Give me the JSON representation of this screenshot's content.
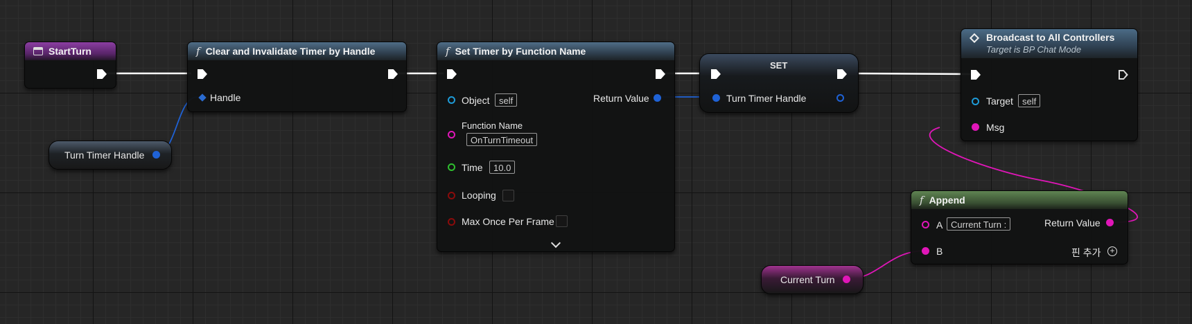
{
  "colors": {
    "exec": "#ffffff",
    "struct_pin": "#1f62d6",
    "object_pin": "#1e9bd8",
    "string_pin": "#e016b8",
    "float_pin": "#2fbf2f",
    "bool_pin": "#8a0b0b"
  },
  "start_turn": {
    "title": "StartTurn",
    "icon": "event-icon"
  },
  "clear_timer": {
    "title": "Clear and Invalidate Timer by Handle",
    "icon": "function-icon",
    "handle_label": "Handle"
  },
  "turn_timer_var": {
    "label": "Turn Timer Handle"
  },
  "set_timer": {
    "title": "Set Timer by Function Name",
    "icon": "function-icon",
    "object_label": "Object",
    "object_value": "self",
    "return_label": "Return Value",
    "function_name_label": "Function Name",
    "function_name_value": "OnTurnTimeout",
    "time_label": "Time",
    "time_value": "10.0",
    "looping_label": "Looping",
    "max_once_label": "Max Once Per Frame"
  },
  "set_node": {
    "title": "SET",
    "pin_label": "Turn Timer Handle"
  },
  "broadcast": {
    "title": "Broadcast to All Controllers",
    "subtitle": "Target is BP Chat Mode",
    "icon": "broadcast-icon",
    "target_label": "Target",
    "target_value": "self",
    "msg_label": "Msg"
  },
  "append": {
    "title": "Append",
    "icon": "function-icon",
    "a_label": "A",
    "a_value": "Current Turn :",
    "return_label": "Return Value",
    "b_label": "B",
    "add_pin_label": "핀 추가"
  },
  "current_turn_var": {
    "label": "Current Turn"
  }
}
